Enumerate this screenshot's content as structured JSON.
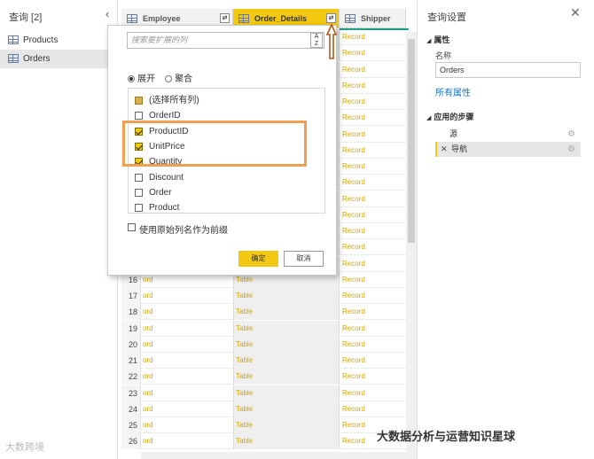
{
  "queries": {
    "title": "查询 [2]",
    "items": [
      {
        "label": "Products",
        "active": false
      },
      {
        "label": "Orders",
        "active": true
      }
    ]
  },
  "grid": {
    "columns": [
      {
        "name": "Employee",
        "selected": false
      },
      {
        "name": "Order_Details",
        "selected": true
      },
      {
        "name": "Shipper",
        "selected": false
      }
    ],
    "rows": [
      {
        "n": "",
        "c1": "",
        "c2": "",
        "c3": "Record"
      },
      {
        "n": "",
        "c1": "",
        "c2": "",
        "c3": "Record"
      },
      {
        "n": "",
        "c1": "",
        "c2": "",
        "c3": "Record"
      },
      {
        "n": "",
        "c1": "",
        "c2": "",
        "c3": "Record"
      },
      {
        "n": "",
        "c1": "",
        "c2": "",
        "c3": "Record"
      },
      {
        "n": "",
        "c1": "",
        "c2": "",
        "c3": "Record"
      },
      {
        "n": "",
        "c1": "",
        "c2": "",
        "c3": "Record"
      },
      {
        "n": "",
        "c1": "",
        "c2": "",
        "c3": "Record"
      },
      {
        "n": "",
        "c1": "",
        "c2": "",
        "c3": "Record"
      },
      {
        "n": "",
        "c1": "",
        "c2": "",
        "c3": "Record"
      },
      {
        "n": "",
        "c1": "",
        "c2": "",
        "c3": "Record"
      },
      {
        "n": "",
        "c1": "",
        "c2": "",
        "c3": "Record"
      },
      {
        "n": "",
        "c1": "",
        "c2": "",
        "c3": "Record"
      },
      {
        "n": "",
        "c1": "",
        "c2": "",
        "c3": "Record"
      },
      {
        "n": "",
        "c1": "",
        "c2": "",
        "c3": "Record"
      },
      {
        "n": "16",
        "c1": "ord",
        "c2": "Table",
        "c3": "Record"
      },
      {
        "n": "17",
        "c1": "ord",
        "c2": "Table",
        "c3": "Record"
      },
      {
        "n": "18",
        "c1": "ord",
        "c2": "Table",
        "c3": "Record"
      },
      {
        "n": "19",
        "c1": "ord",
        "c2": "Table",
        "c3": "Record"
      },
      {
        "n": "20",
        "c1": "ord",
        "c2": "Table",
        "c3": "Record"
      },
      {
        "n": "21",
        "c1": "ord",
        "c2": "Table",
        "c3": "Record"
      },
      {
        "n": "22",
        "c1": "ord",
        "c2": "Table",
        "c3": "Record"
      },
      {
        "n": "23",
        "c1": "ord",
        "c2": "Table",
        "c3": "Record"
      },
      {
        "n": "24",
        "c1": "ord",
        "c2": "Table",
        "c3": "Record"
      },
      {
        "n": "25",
        "c1": "ord",
        "c2": "Table",
        "c3": "Record"
      },
      {
        "n": "26",
        "c1": "ord",
        "c2": "Table",
        "c3": "Record"
      }
    ]
  },
  "popup": {
    "search_placeholder": "搜索要扩展的列",
    "sort_icon": "sort-az-icon",
    "radio_expand": "展开",
    "radio_aggregate": "聚合",
    "columns": [
      {
        "label": "(选择所有列)",
        "state": "partial"
      },
      {
        "label": "OrderID",
        "state": "off"
      },
      {
        "label": "ProductID",
        "state": "on"
      },
      {
        "label": "UnitPrice",
        "state": "on"
      },
      {
        "label": "Quantity",
        "state": "on"
      },
      {
        "label": "Discount",
        "state": "off"
      },
      {
        "label": "Order",
        "state": "off"
      },
      {
        "label": "Product",
        "state": "off"
      }
    ],
    "prefix_label": "使用原始列名作为前缀",
    "ok_label": "确定",
    "cancel_label": "取消"
  },
  "settings": {
    "title": "查询设置",
    "properties_heading": "属性",
    "name_label": "名称",
    "name_value": "Orders",
    "all_properties_link": "所有属性",
    "steps_heading": "应用的步骤",
    "steps": [
      {
        "label": "源",
        "selected": false
      },
      {
        "label": "导航",
        "selected": true
      }
    ]
  },
  "watermarks": {
    "left": "大数跨境",
    "right": "大数据分析与运营知识星球"
  },
  "colors": {
    "accent": "#f2c811",
    "highlight_box": "#f0a050",
    "arrow": "#b3591a",
    "record_text": "#d7a500",
    "link": "#1577c9"
  }
}
